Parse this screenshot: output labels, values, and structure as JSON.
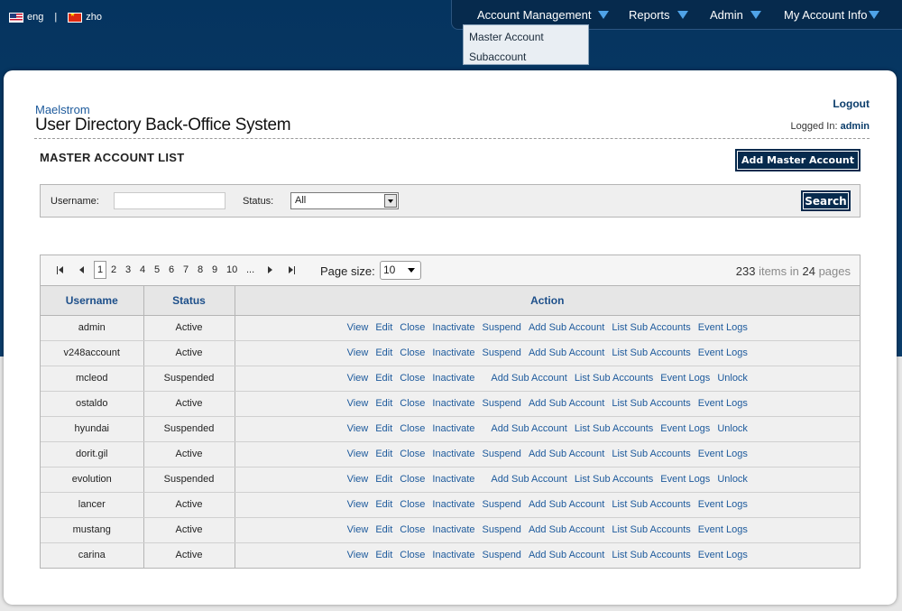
{
  "languages": [
    {
      "code": "eng",
      "flag": "us-flag-icon"
    },
    {
      "code": "zho",
      "flag": "china-flag-icon"
    }
  ],
  "lang_separator": "|",
  "nav": {
    "items": [
      "Account Management",
      "Reports",
      "Admin",
      "My Account Info"
    ],
    "dropdown": [
      "Master Account",
      "Subaccount"
    ]
  },
  "brand": {
    "small": "Maelstrom",
    "big": "User Directory Back-Office System"
  },
  "user": {
    "logout": "Logout",
    "logged_in_label": "Logged In:",
    "name": "admin"
  },
  "page": {
    "title": "MASTER ACCOUNT LIST",
    "add_button": "Add Master Account"
  },
  "filter": {
    "username_label": "Username:",
    "username_value": "",
    "status_label": "Status:",
    "status_value": "All",
    "search_button": "Search"
  },
  "pager": {
    "pages": [
      "1",
      "2",
      "3",
      "4",
      "5",
      "6",
      "7",
      "8",
      "9",
      "10",
      "..."
    ],
    "current": "1",
    "page_size_label": "Page size:",
    "page_size": "10",
    "total_items": "233",
    "items_in_text": "items in",
    "total_pages": "24",
    "pages_text": "pages"
  },
  "columns": [
    "Username",
    "Status",
    "Action"
  ],
  "actions": {
    "active": [
      "View",
      "Edit",
      "Close",
      "Inactivate",
      "Suspend",
      "Add Sub Account",
      "List Sub Accounts",
      "Event Logs"
    ],
    "suspended": [
      "View",
      "Edit",
      "Close",
      "Inactivate",
      "",
      "Add Sub Account",
      "List Sub Accounts",
      "Event Logs",
      "Unlock"
    ]
  },
  "rows": [
    {
      "username": "admin",
      "status": "Active"
    },
    {
      "username": "v248account",
      "status": "Active"
    },
    {
      "username": "mcleod",
      "status": "Suspended"
    },
    {
      "username": "ostaldo",
      "status": "Active"
    },
    {
      "username": "hyundai",
      "status": "Suspended"
    },
    {
      "username": "dorit.gil",
      "status": "Active"
    },
    {
      "username": "evolution",
      "status": "Suspended"
    },
    {
      "username": "lancer",
      "status": "Active"
    },
    {
      "username": "mustang",
      "status": "Active"
    },
    {
      "username": "carina",
      "status": "Active"
    }
  ]
}
